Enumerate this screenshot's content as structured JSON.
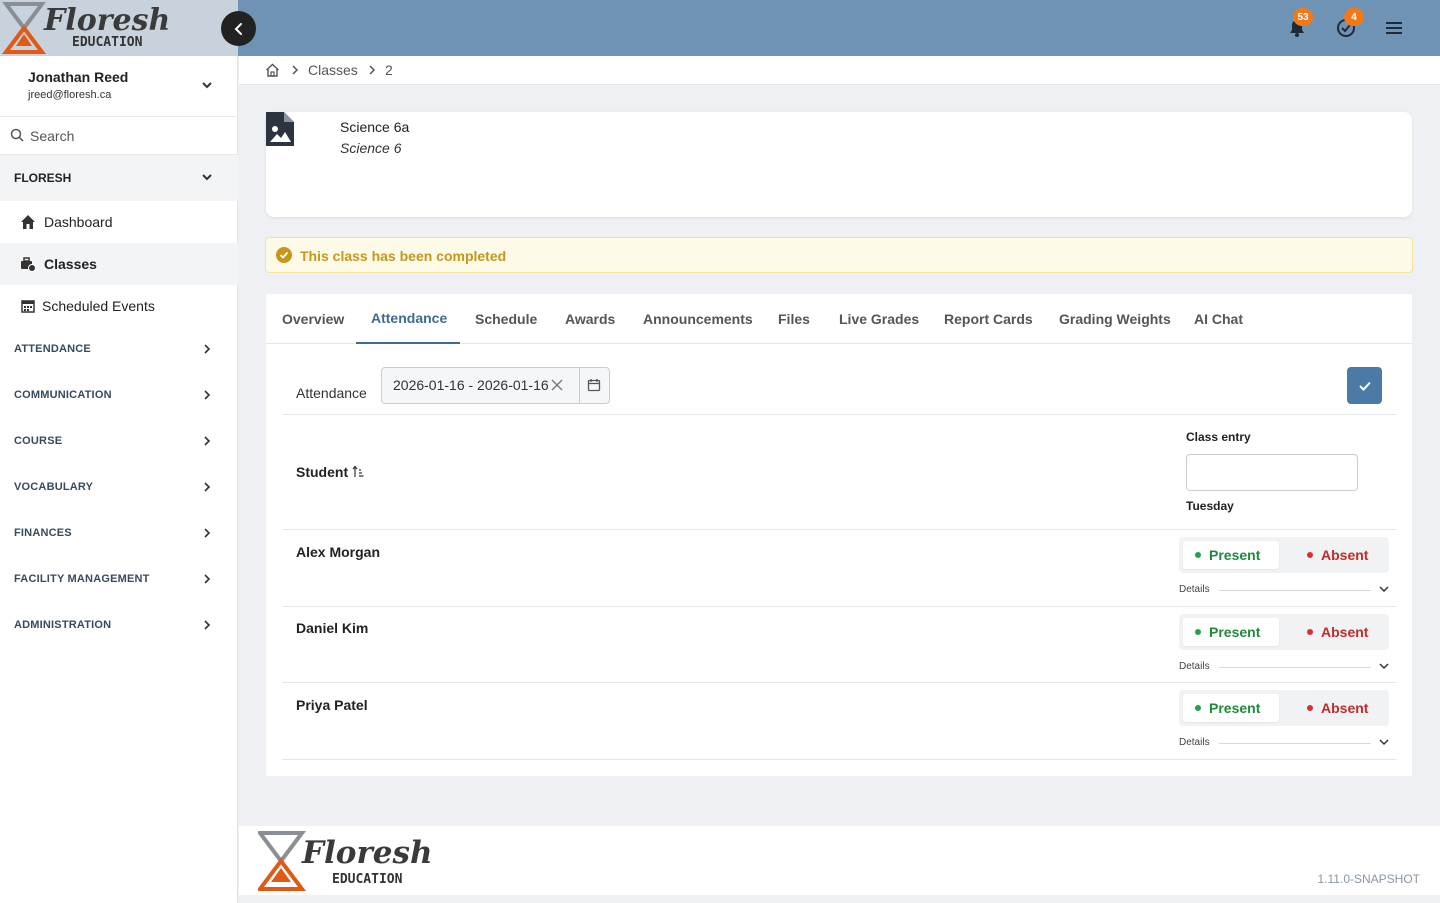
{
  "brand": {
    "logo_text": "Floresh",
    "logo_sub": "EDUCATION"
  },
  "topbar": {
    "notifications_count": "53",
    "tasks_count": "4"
  },
  "user": {
    "name": "Jonathan Reed",
    "email": "jreed@floresh.ca"
  },
  "search": {
    "placeholder": "Search"
  },
  "sidebar": {
    "group": "FLORESH",
    "items": [
      {
        "label": "Dashboard",
        "icon": "home-icon"
      },
      {
        "label": "Classes",
        "icon": "classes-icon",
        "active": true
      },
      {
        "label": "Scheduled Events",
        "icon": "calendar-icon"
      }
    ],
    "sections": [
      "ATTENDANCE",
      "COMMUNICATION",
      "COURSE",
      "VOCABULARY",
      "FINANCES",
      "FACILITY MANAGEMENT",
      "ADMINISTRATION"
    ]
  },
  "breadcrumb": {
    "classes": "Classes",
    "current": "2"
  },
  "class": {
    "name": "Science 6a",
    "course": "Science 6"
  },
  "banner": {
    "text": "This class has been completed"
  },
  "tabs": [
    "Overview",
    "Attendance",
    "Schedule",
    "Awards",
    "Announcements",
    "Files",
    "Live Grades",
    "Report Cards",
    "Grading Weights",
    "AI Chat"
  ],
  "attendance": {
    "label": "Attendance",
    "date_range": "2026-01-16 - 2026-01-16",
    "student_header": "Student",
    "class_entry_label": "Class entry",
    "day": "Tuesday",
    "present_label": "Present",
    "absent_label": "Absent",
    "details_label": "Details",
    "students": [
      "Alex Morgan",
      "Daniel Kim",
      "Priya Patel"
    ]
  },
  "footer": {
    "version": "1.11.0-SNAPSHOT"
  },
  "colors": {
    "topbar": "#6e93b4",
    "accent": "#3f6a92",
    "present": "#1f8a3b",
    "absent": "#c42a2a",
    "banner_text": "#c7961a"
  }
}
